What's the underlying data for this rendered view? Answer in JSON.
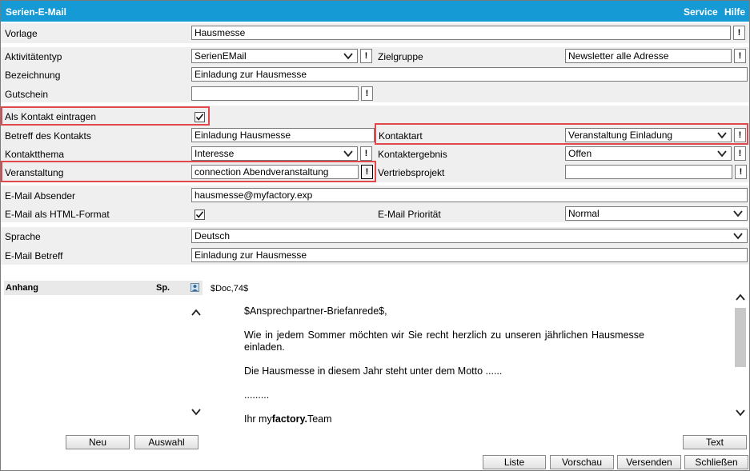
{
  "window": {
    "title": "Serien-E-Mail",
    "menu": [
      "Service",
      "Hilfe"
    ]
  },
  "form": {
    "vorlage": {
      "label": "Vorlage",
      "value": "Hausmesse"
    },
    "aktivitaetentyp": {
      "label": "Aktivitätentyp",
      "value": "SerienEMail"
    },
    "zielgruppe": {
      "label": "Zielgruppe",
      "value": "Newsletter alle Adresse"
    },
    "bezeichnung": {
      "label": "Bezeichnung",
      "value": "Einladung zur Hausmesse"
    },
    "gutschein": {
      "label": "Gutschein",
      "value": ""
    },
    "als_kontakt": {
      "label": "Als Kontakt eintragen",
      "checked": true
    },
    "betreff_kontakt": {
      "label": "Betreff des Kontakts",
      "value": "Einladung Hausmesse"
    },
    "kontaktart": {
      "label": "Kontaktart",
      "value": "Veranstaltung Einladung"
    },
    "kontaktthema": {
      "label": "Kontaktthema",
      "value": "Interesse"
    },
    "kontaktergebnis": {
      "label": "Kontaktergebnis",
      "value": "Offen"
    },
    "veranstaltung": {
      "label": "Veranstaltung",
      "value": "connection Abendveranstaltung"
    },
    "vertriebsprojekt": {
      "label": "Vertriebsprojekt",
      "value": ""
    },
    "email_absender": {
      "label": "E-Mail Absender",
      "value": "hausmesse@myfactory.exp"
    },
    "html_format": {
      "label": "E-Mail als HTML-Format",
      "checked": true
    },
    "prioritaet": {
      "label": "E-Mail Priorität",
      "value": "Normal"
    },
    "sprache": {
      "label": "Sprache",
      "value": "Deutsch"
    },
    "email_betreff": {
      "label": "E-Mail Betreff",
      "value": "Einladung zur Hausmesse"
    }
  },
  "attachments": {
    "header": "Anhang",
    "col_sp": "Sp."
  },
  "editor": {
    "doc_tag": "$Doc,74$",
    "salutation": "$Ansprechpartner-Briefanrede$,",
    "para1": "Wie in jedem Sommer möchten wir Sie recht herzlich zu unseren jährlichen Hausmesse einladen.",
    "para2": "Die Hausmesse in diesem Jahr steht unter dem Motto ......",
    "para3": ".........",
    "closing_prefix": "Ihr my",
    "closing_brand": "factory.",
    "closing_suffix": "Team"
  },
  "buttons": {
    "neu": "Neu",
    "auswahl": "Auswahl",
    "text": "Text",
    "liste": "Liste",
    "vorschau": "Vorschau",
    "versenden": "Versenden",
    "schliessen": "Schließen"
  },
  "colors": {
    "titlebar": "#159ad6",
    "highlight": "#e0484c",
    "band": "#efefef"
  }
}
